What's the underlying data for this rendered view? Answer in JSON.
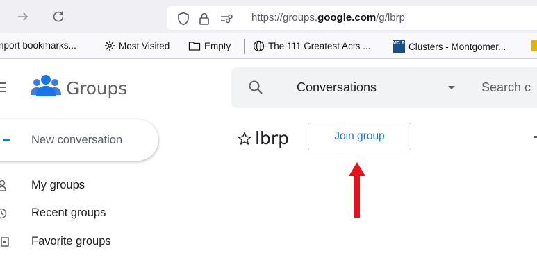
{
  "browser": {
    "url": {
      "prefix": "https://groups.",
      "host": "google.com",
      "path": "/g/lbrp"
    },
    "bookmarks": [
      {
        "label": "nport bookmarks...",
        "icon": "import-icon"
      },
      {
        "label": "Most Visited",
        "icon": "gear-icon"
      },
      {
        "label": "Empty",
        "icon": "folder-icon"
      },
      {
        "label": "The 111 Greatest Acts ...",
        "icon": "globe-icon"
      },
      {
        "label": "Clusters - Montgomer...",
        "icon": "mcps-icon",
        "icon_text": "MC PS"
      }
    ]
  },
  "app": {
    "title": "Groups",
    "brand_color": "#1a73e8"
  },
  "search": {
    "scope": "Conversations",
    "placeholder": "Search c"
  },
  "sidebar": {
    "new_conversation": "New conversation",
    "items": [
      {
        "label": "My groups",
        "icon": "person-icon"
      },
      {
        "label": "Recent groups",
        "icon": "clock-icon"
      },
      {
        "label": "Favorite groups",
        "icon": "star-box-icon"
      }
    ]
  },
  "group": {
    "name": "lbrp",
    "join_label": "Join group"
  },
  "annotation": {
    "arrow_color": "#e8101a"
  }
}
